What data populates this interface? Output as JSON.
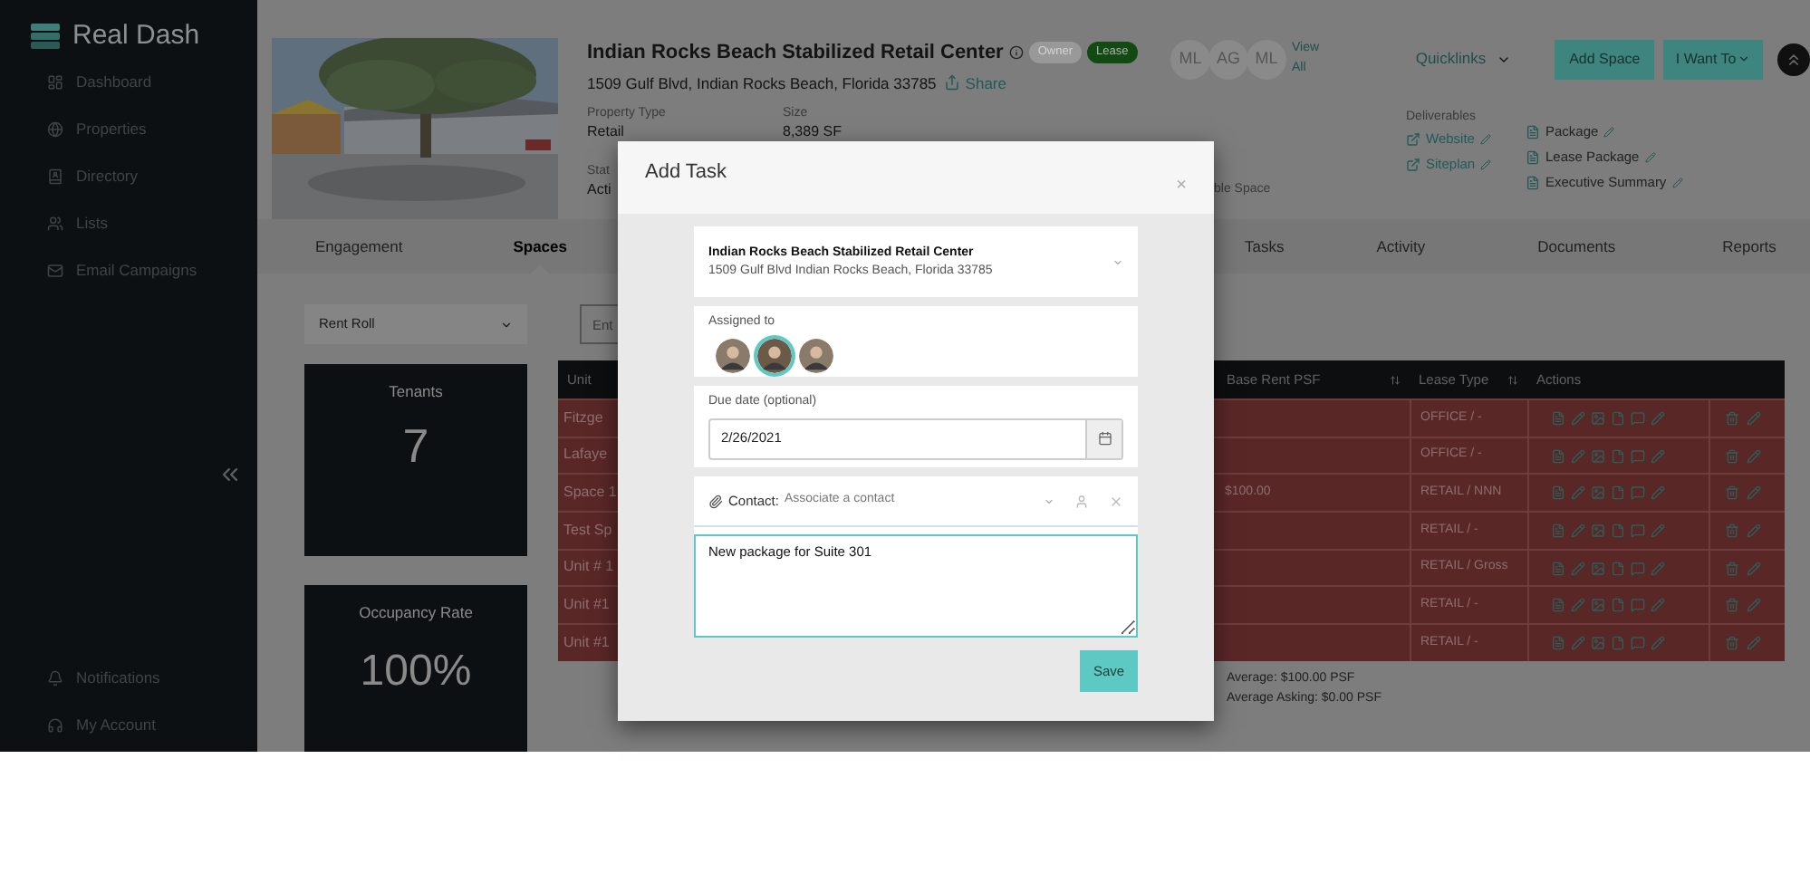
{
  "sidebar": {
    "brand": "Real Dash",
    "items": [
      {
        "label": "Dashboard"
      },
      {
        "label": "Properties"
      },
      {
        "label": "Directory"
      },
      {
        "label": "Lists"
      },
      {
        "label": "Email Campaigns"
      }
    ],
    "bottom_items": [
      {
        "label": "Notifications"
      },
      {
        "label": "My Account"
      }
    ]
  },
  "property": {
    "title": "Indian Rocks Beach Stabilized Retail Center",
    "address": "1509 Gulf Blvd, Indian Rocks Beach, Florida 33785",
    "share": "Share",
    "badges": [
      {
        "label": "Owner",
        "kind": "muted"
      },
      {
        "label": "Lease",
        "kind": "active"
      }
    ],
    "facts": [
      {
        "label": "Property Type",
        "value": "Retail"
      },
      {
        "label": "Size",
        "value": "8,389 SF"
      }
    ],
    "facts_row2": [
      {
        "label": "Stat",
        "value": "Acti"
      }
    ],
    "fact_fragment": "ble Space",
    "team": [
      "ML",
      "AG",
      "ML"
    ],
    "view_all": "View All",
    "quicklinks": "Quicklinks",
    "buttons": [
      "Add Space",
      "I Want To"
    ],
    "deliverables": {
      "title": "Deliverables",
      "links": [
        {
          "label": "Website"
        },
        {
          "label": "Siteplan"
        }
      ],
      "documents": [
        {
          "label": "Package"
        },
        {
          "label": "Lease Package"
        },
        {
          "label": "Executive Summary"
        }
      ]
    }
  },
  "tabs": [
    {
      "label": "Engagement",
      "selected": false
    },
    {
      "label": "Spaces",
      "selected": true
    },
    {
      "label": "Tasks",
      "selected": false
    },
    {
      "label": "Activity",
      "selected": false
    },
    {
      "label": "Documents",
      "selected": false
    },
    {
      "label": "Reports",
      "selected": false
    }
  ],
  "view_select": "Rent Roll",
  "search": {
    "placeholder": "Ent"
  },
  "stats": [
    {
      "label": "Tenants",
      "value": "7"
    },
    {
      "label": "Occupancy Rate",
      "value": "100%"
    }
  ],
  "table": {
    "columns": [
      {
        "label": "Unit",
        "sortable": false
      },
      {
        "label": "Base Rent PSF",
        "sortable": true
      },
      {
        "label": "Lease Type",
        "sortable": true
      },
      {
        "label": "Actions",
        "sortable": false
      }
    ],
    "rows": [
      {
        "unit": "Fitzge",
        "lease_type": "OFFICE / -"
      },
      {
        "unit": "Lafaye",
        "lease_type": "OFFICE / -"
      },
      {
        "unit": "Space 1",
        "base_rent": "$100.00",
        "lease_type": "RETAIL / NNN"
      },
      {
        "unit": "Test Sp",
        "lease_type": "RETAIL / -"
      },
      {
        "unit": "Unit # 1",
        "lease_type": "RETAIL / Gross"
      },
      {
        "unit": "Unit #1",
        "lease_type": "RETAIL / -"
      },
      {
        "unit": "Unit #1",
        "lease_type": "RETAIL / -"
      }
    ],
    "summary": [
      "Average: $100.00 PSF",
      "Average Asking: $0.00 PSF"
    ]
  },
  "modal": {
    "title": "Add Task",
    "close": "×",
    "property": {
      "name": "Indian Rocks Beach Stabilized Retail Center",
      "address": "1509 Gulf Blvd Indian Rocks Beach, Florida 33785"
    },
    "assigned_label": "Assigned to",
    "assignees": [
      {
        "selected": false
      },
      {
        "selected": true
      },
      {
        "selected": false
      }
    ],
    "due_label": "Due date (optional)",
    "due_value": "2/26/2021",
    "contact_label": "Contact:",
    "contact_placeholder": "Associate a contact",
    "note": "New package for Suite 301",
    "save": "Save"
  }
}
